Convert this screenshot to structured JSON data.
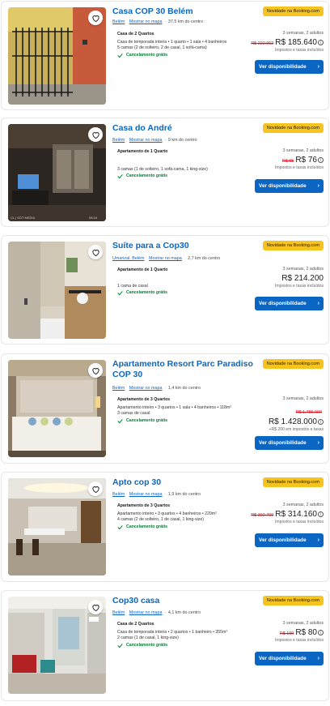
{
  "listings": [
    {
      "name": "Casa COP 30 Belém",
      "badge": "Novidade na Booking.com",
      "location": "Belém",
      "map_link": "Mostrar no mapa",
      "distance": "37,5 km do centro",
      "room_type": "Casa de 2 Quartos",
      "room_desc": "Casa de temporada inteira • 1 quarto • 1 sala • 4 banheiros",
      "beds": "5 camas (2 de solteiro, 2 de casal, 1 sofá-cama)",
      "cancellation": "Cancelamento grátis",
      "stay": "3 semanas, 2 adultos",
      "old_price": "R$ 222.062",
      "price": "R$ 185.640",
      "taxes": "Impostos e taxas incluídos",
      "button": "Ver disponibilidade"
    },
    {
      "name": "Casa do André",
      "badge": "Novidade na Booking.com",
      "location": "Belém",
      "map_link": "Mostrar no mapa",
      "distance": "9 km do centro",
      "room_type": "Apartamento de 1 Quarto",
      "room_desc": "",
      "beds": "3 camas (1 de solteiro, 1 sofá-cama, 1 king-size)",
      "cancellation": "Cancelamento grátis",
      "stay": "3 semanas, 2 adultos",
      "old_price": "R$ 95",
      "price": "R$ 76",
      "taxes": "Impostos e taxas incluídos",
      "button": "Ver disponibilidade"
    },
    {
      "name": "Suíte para a Cop30",
      "badge": "Novidade na Booking.com",
      "location": "Umarizal, Belém",
      "map_link": "Mostrar no mapa",
      "distance": "2,7 km do centro",
      "room_type": "Apartamento de 1 Quarto",
      "room_desc": "",
      "beds": "1 cama de casal",
      "cancellation": "Cancelamento grátis",
      "stay": "3 semanas, 2 adultos",
      "old_price": "",
      "price": "R$ 214.200",
      "taxes": "Impostos e taxas incluídos",
      "button": "Ver disponibilidade"
    },
    {
      "name": "Apartamento Resort Parc Paradiso COP 30",
      "badge": "Novidade na Booking.com",
      "location": "Belém",
      "map_link": "Mostrar no mapa",
      "distance": "1,4 km do centro",
      "room_type": "Apartamento de 3 Quartos",
      "room_desc": "Apartamento inteiro • 3 quartos • 1 sala • 4 banheiros • 118m²",
      "beds": "3 camas de casal",
      "cancellation": "Cancelamento grátis",
      "stay": "3 semanas, 2 adultos",
      "old_price": "R$ 1.785.000",
      "price": "R$ 1.428.000",
      "taxes": "+R$ 200 em impostos e taxas",
      "button": "Ver disponibilidade"
    },
    {
      "name": "Apto cop 30",
      "badge": "Novidade na Booking.com",
      "location": "Belém",
      "map_link": "Mostrar no mapa",
      "distance": "1,9 km do centro",
      "room_type": "Apartamento de 3 Quartos",
      "room_desc": "Apartamento inteiro • 3 quartos • 4 banheiros • 220m²",
      "beds": "4 camas (2 de solteiro, 1 de casal, 1 king-size)",
      "cancellation": "Cancelamento grátis",
      "stay": "3 semanas, 2 adultos",
      "old_price": "R$ 392.700",
      "price": "R$ 314.160",
      "taxes": "Impostos e taxas incluídos",
      "button": "Ver disponibilidade"
    },
    {
      "name": "Cop30 casa",
      "badge": "Novidade na Booking.com",
      "location": "Belém",
      "map_link": "Mostrar no mapa",
      "distance": "4,1 km do centro",
      "room_type": "Casa de 2 Quartos",
      "room_desc": "Casa de temporada inteira • 2 quartos • 1 banheiro • 355m²",
      "beds": "2 camas (1 de casal, 1 king-size)",
      "cancellation": "Cancelamento grátis",
      "stay": "3 semanas, 2 adultos",
      "old_price": "R$ 100",
      "price": "R$ 80",
      "taxes": "Impostos e taxas incluídos",
      "button": "Ver disponibilidade"
    }
  ],
  "colors": {
    "link": "#0a66c2",
    "badge": "#f7c31f",
    "green": "#008234",
    "old_price": "#d4111e"
  }
}
